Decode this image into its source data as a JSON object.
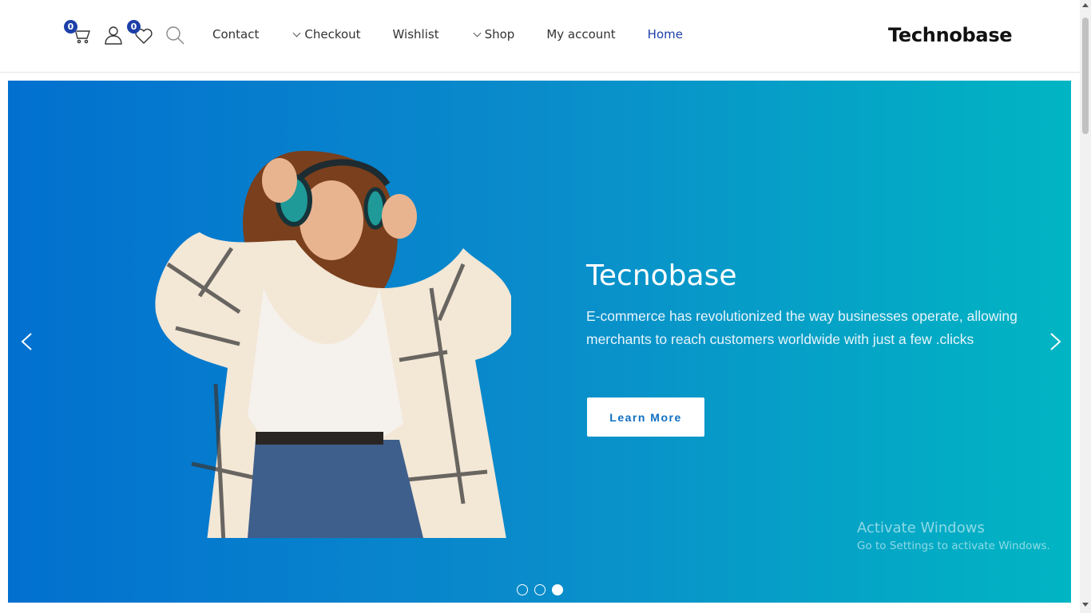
{
  "header": {
    "cart": {
      "icon": "cart-icon",
      "count": "0"
    },
    "account": {
      "icon": "user-icon"
    },
    "wishlist": {
      "icon": "heart-icon",
      "count": "0"
    },
    "search": {
      "icon": "search-icon"
    },
    "nav": [
      {
        "label": "Contact",
        "dropdown": false,
        "active": false
      },
      {
        "label": "Checkout",
        "dropdown": true,
        "active": false
      },
      {
        "label": "Wishlist",
        "dropdown": false,
        "active": false
      },
      {
        "label": "Shop",
        "dropdown": true,
        "active": false
      },
      {
        "label": "My account",
        "dropdown": false,
        "active": false
      },
      {
        "label": "Home",
        "dropdown": false,
        "active": true
      }
    ],
    "logo": "Technobase"
  },
  "hero": {
    "title": "Tecnobase",
    "text": "E-commerce has revolutionized the way businesses operate, allowing merchants to reach customers worldwide with just a few .clicks",
    "button": "Learn More",
    "slides": 3,
    "active_slide": 3,
    "image": "woman-with-headphones"
  },
  "watermark": {
    "title": "Activate Windows",
    "subtitle": "Go to Settings to activate Windows."
  },
  "colors": {
    "accent": "#1c3fa8",
    "hero_start": "#0270cf",
    "hero_end": "#01b5c3",
    "button_text": "#0f6fc2"
  }
}
